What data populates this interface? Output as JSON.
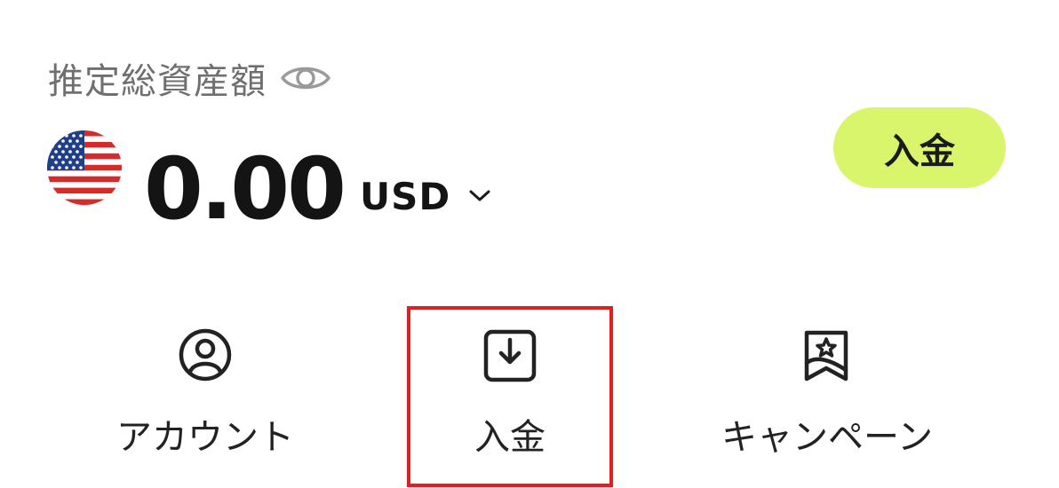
{
  "total_assets": {
    "label": "推定総資産額",
    "visibility_icon": "eye-icon"
  },
  "balance": {
    "flag_icon": "us-flag-icon",
    "amount": "0.00",
    "currency": "USD",
    "currency_icon": "chevron-down-icon"
  },
  "deposit_button": {
    "label": "入金",
    "color": "#d9f56b"
  },
  "actions": [
    {
      "icon": "user-circle-icon",
      "label": "アカウント"
    },
    {
      "icon": "download-tray-icon",
      "label": "入金"
    },
    {
      "icon": "star-bookmark-icon",
      "label": "キャンペーン"
    }
  ],
  "highlight_color": "#e02020"
}
